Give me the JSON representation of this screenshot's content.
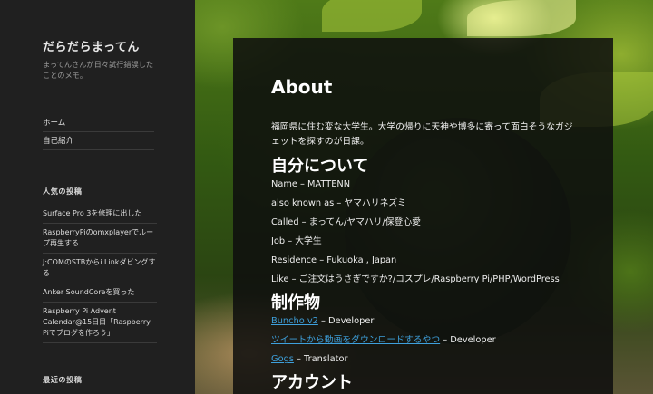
{
  "site": {
    "title": "だらだらまってん",
    "description": "まってんさんが日々試行錯誤したことのメモ。"
  },
  "menu": {
    "items": [
      {
        "label": "ホーム"
      },
      {
        "label": "自己紹介"
      }
    ]
  },
  "popular_posts": {
    "heading": "人気の投稿",
    "items": [
      {
        "label": "Surface Pro 3を修理に出した"
      },
      {
        "label": "RaspberryPiのomxplayerでループ再生する"
      },
      {
        "label": "J:COMのSTBからi.Linkダビングする"
      },
      {
        "label": "Anker SoundCoreを買った"
      },
      {
        "label": "Raspberry Pi Advent Calendar@15日目「Raspberry Piでブログを作ろう」"
      }
    ]
  },
  "recent_posts": {
    "heading": "最近の投稿"
  },
  "article": {
    "title": "About",
    "intro": "福岡県に住む変な大学生。大学の帰りに天神や博多に寄って面白そうなガジェットを探すのが日課。",
    "about_heading": "自分について",
    "about_lines": [
      "Name – MATTENN",
      "also known as – ヤマハリネズミ",
      "Called – まってん/ヤマハリ/保登心愛",
      "Job – 大学生",
      "Residence – Fukuoka , Japan",
      "Like – ご注文はうさぎですか?/コスプレ/Raspberry Pi/PHP/WordPress"
    ],
    "works_heading": "制作物",
    "works": [
      {
        "link": "Buncho v2",
        "role": " – Developer"
      },
      {
        "link": "ツイートから動画をダウンロードするやつ",
        "role": " – Developer"
      },
      {
        "link": "Gogs",
        "role": " – Translator"
      }
    ],
    "accounts_heading": "アカウント"
  },
  "colors": {
    "sidebar_bg": "#202020",
    "link": "#3ea0dc",
    "panel_bg": "rgba(14,14,14,0.86)"
  }
}
